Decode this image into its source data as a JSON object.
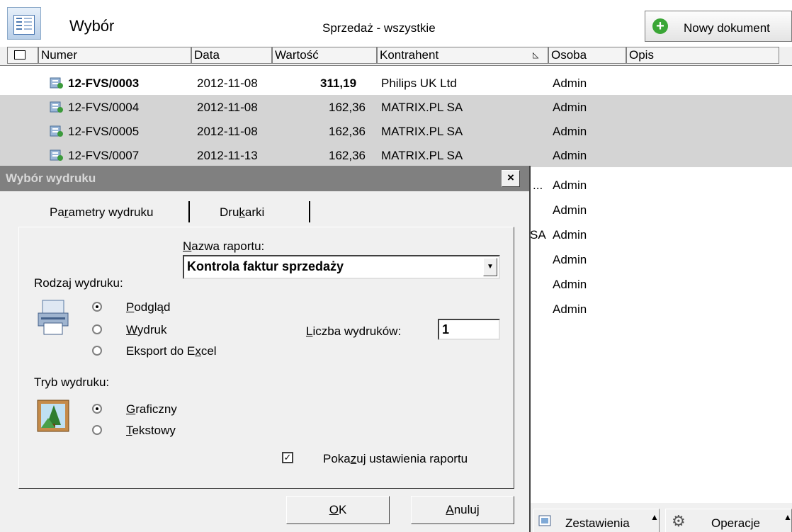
{
  "topbar": {
    "wybor_label": "Wybór",
    "view_title": "Sprzedaż - wszystkie",
    "new_doc_label": "Nowy dokument"
  },
  "grid": {
    "columns": [
      "Numer",
      "Data",
      "Wartość",
      "Kontrahent",
      "Osoba",
      "Opis"
    ],
    "rows": [
      {
        "numer": "12-FVS/0003",
        "data": "2012-11-08",
        "wartosc": "311,19",
        "kontrahent": "Philips UK Ltd",
        "osoba": "Admin"
      },
      {
        "numer": "12-FVS/0004",
        "data": "2012-11-08",
        "wartosc": "162,36",
        "kontrahent": "MATRIX.PL SA",
        "osoba": "Admin"
      },
      {
        "numer": "12-FVS/0005",
        "data": "2012-11-08",
        "wartosc": "162,36",
        "kontrahent": "MATRIX.PL SA",
        "osoba": "Admin"
      },
      {
        "numer": "12-FVS/0007",
        "data": "2012-11-13",
        "wartosc": "162,36",
        "kontrahent": "MATRIX.PL SA",
        "osoba": "Admin"
      },
      {
        "kontrahent_tail": "...",
        "osoba": "Admin"
      },
      {
        "osoba": "Admin"
      },
      {
        "kontrahent_tail": "SA",
        "osoba": "Admin"
      },
      {
        "osoba": "Admin"
      },
      {
        "osoba": "Admin"
      },
      {
        "osoba": "Admin"
      }
    ]
  },
  "dialog": {
    "title": "Wybór wydruku",
    "close": "×",
    "tab_params_pre": "Pa",
    "tab_params_u": "r",
    "tab_params_post": "ametry wydruku",
    "tab_printers_pre": "Dru",
    "tab_printers_u": "k",
    "tab_printers_post": "arki",
    "report_name_label_u": "N",
    "report_name_label_rest": "azwa raportu:",
    "report_name_value": "Kontrola faktur sprzedaży",
    "print_type_label": "Rodzaj wydruku:",
    "opt_preview_u": "P",
    "opt_preview_rest": "odgląd",
    "opt_print_u": "W",
    "opt_print_rest": "ydruk",
    "opt_excel_pre": "Eksport do E",
    "opt_excel_u": "x",
    "opt_excel_post": "cel",
    "copies_label_u": "L",
    "copies_label_rest": "iczba wydruków:",
    "copies_value": "1",
    "mode_label": "Tryb wydruku:",
    "opt_graphic_u": "G",
    "opt_graphic_rest": "raficzny",
    "opt_text_u": "T",
    "opt_text_rest": "ekstowy",
    "show_settings_pre": "Poka",
    "show_settings_u": "z",
    "show_settings_post": "uj ustawienia raportu",
    "ok_u": "O",
    "ok_rest": "K",
    "cancel_u": "A",
    "cancel_rest": "nuluj"
  },
  "bottom_bar": {
    "reports_label": "Zestawienia",
    "operations_label": "Operacje"
  }
}
